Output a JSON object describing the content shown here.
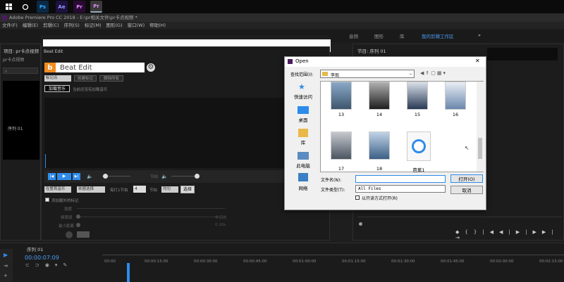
{
  "taskbar": {
    "apps": [
      "Ps",
      "Ae",
      "Pr",
      "Pr"
    ]
  },
  "app": {
    "title": "Adobe Premiere Pro CC 2018 - E:\\pr相关文件\\pr卡点视频 *"
  },
  "menu": [
    "文件(F)",
    "编辑(E)",
    "剪辑(C)",
    "序列(S)",
    "标记(M)",
    "图形(G)",
    "窗口(W)",
    "帮助(H)"
  ],
  "workspaces": [
    "音频",
    "图形",
    "库",
    "我的剪辑工作区"
  ],
  "project": {
    "tab": "项目: pr卡点视频",
    "filename": "pr卡点视频",
    "seq": "序列 01"
  },
  "program": {
    "tab": "节目: 序列 01"
  },
  "beat": {
    "panel_title": "Beat Edit",
    "title": "Beat Edit",
    "logo": "b",
    "btn_create_markers": "创建标记",
    "btn_delete_all": "删除所有",
    "btn_load_music": "加载音乐",
    "no_music_text": "当前还没有加载音乐",
    "dd_music": "在整首音乐",
    "dd_select": "依据选择",
    "every_label": "每打1节拍",
    "every_value": "4",
    "beat_label": "节拍",
    "dd_uniform": "均匀",
    "select_label": "选择",
    "add_extra": "添加额外的标记",
    "strength": "强度",
    "frequency": "频率段",
    "min_interval": "最小距离",
    "value_interval": "0.10s",
    "mid": "中间的",
    "dd_marker": "标记",
    "dd_placeholder": "标记点"
  },
  "dialog": {
    "title": "Open",
    "lookin_label": "查找范围(I):",
    "lookin_value": "李现",
    "places": [
      "快速访问",
      "桌面",
      "库",
      "此电脑",
      "网络"
    ],
    "files": [
      "13",
      "14",
      "15",
      "16",
      "17",
      "18",
      "芭蕉1"
    ],
    "filename_label": "文件名(N):",
    "filename_value": "",
    "filetype_label": "文件类型(T):",
    "filetype_value": "All Files",
    "readonly": "以只读方式打开(R)",
    "open": "打开(O)",
    "cancel": "取消"
  },
  "timeline": {
    "tab": "序列 01",
    "timecode": "00:00:07:09",
    "ticks": [
      "00:00",
      "00:00:15:00",
      "00:00:30:00",
      "00:00:45:00",
      "00:01:00:00",
      "00:01:15:00",
      "00:01:30:00",
      "00:01:45:00",
      "00:02:00:00",
      "00:02:15:00",
      "00:02:30:00"
    ]
  },
  "colors": {
    "accent": "#2d8ceb",
    "folder": "#e8b94a"
  }
}
